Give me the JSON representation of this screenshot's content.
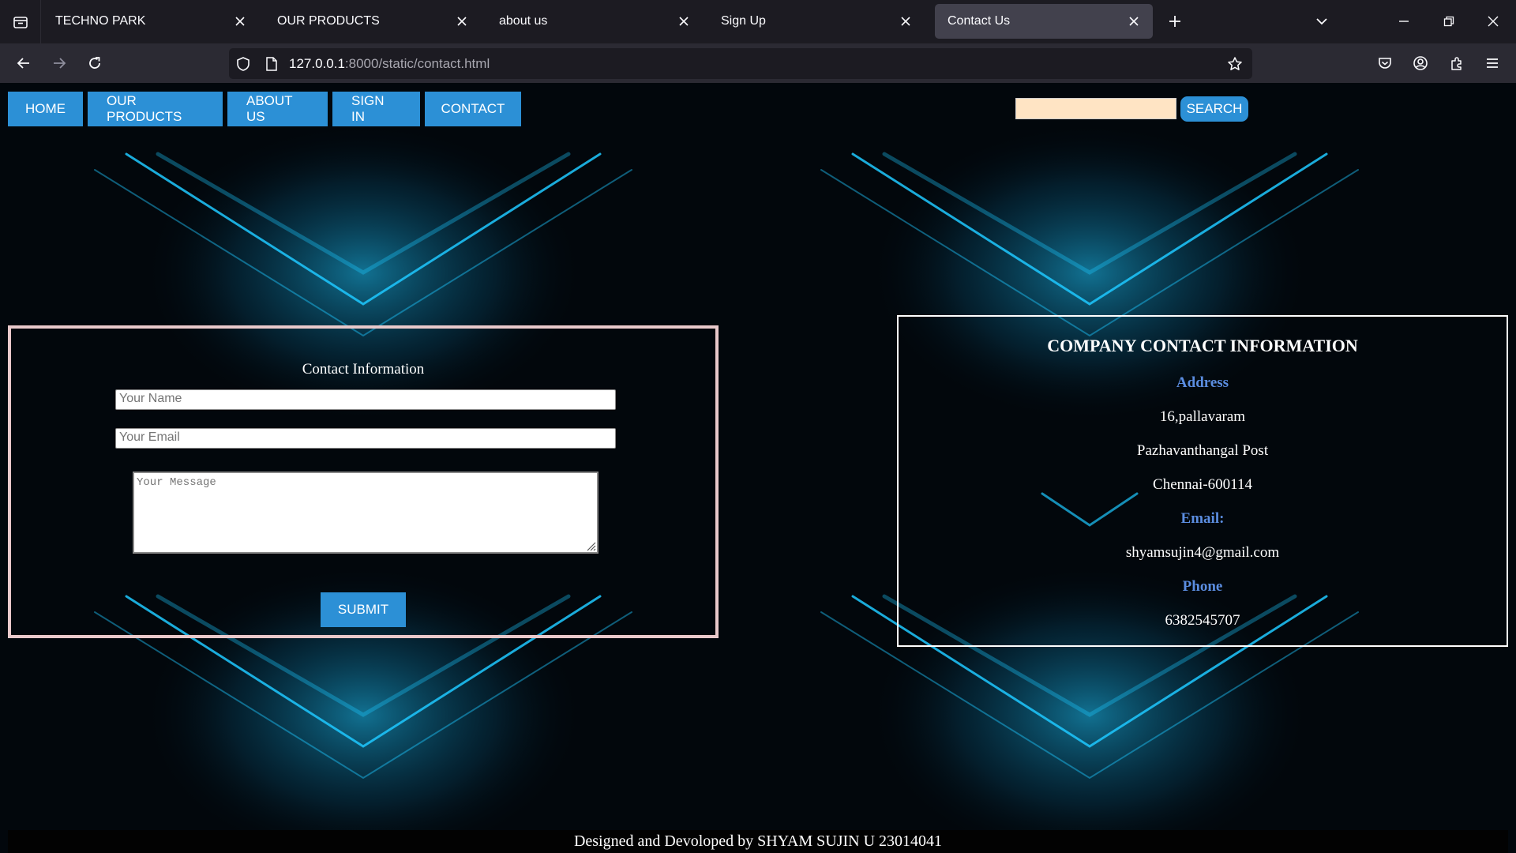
{
  "browser": {
    "tabs": [
      {
        "label": "TECHNO PARK",
        "active": false
      },
      {
        "label": "OUR PRODUCTS",
        "active": false
      },
      {
        "label": "about us",
        "active": false
      },
      {
        "label": "Sign Up",
        "active": false
      },
      {
        "label": "Contact Us",
        "active": true
      }
    ],
    "url_host": "127.0.0.1",
    "url_rest": ":8000/static/contact.html",
    "icons": [
      "tab-list-icon",
      "close-icon",
      "new-tab-icon",
      "chevron-down-icon",
      "minimize-icon",
      "restore-icon",
      "window-close-icon",
      "back-icon",
      "forward-icon",
      "reload-icon",
      "shield-icon",
      "page-icon",
      "star-icon",
      "pocket-icon",
      "account-icon",
      "extensions-icon",
      "menu-icon"
    ]
  },
  "site": {
    "nav": [
      "HOME",
      "OUR PRODUCTS",
      "ABOUT US",
      "SIGN IN",
      "CONTACT"
    ],
    "search_label": "SEARCH",
    "search_value": ""
  },
  "form": {
    "title": "Contact Information",
    "name_placeholder": "Your Name",
    "email_placeholder": "Your Email",
    "message_placeholder": "Your Message",
    "submit_label": "SUBMIT"
  },
  "company": {
    "title": "COMPANY CONTACT INFORMATION",
    "address_heading": "Address",
    "address_line1": "16,pallavaram",
    "address_line2": "Pazhavanthangal Post",
    "address_line3": "Chennai-600114",
    "email_heading": "Email:",
    "email": "shyamsujin4@gmail.com",
    "phone_heading": "Phone",
    "phone": "6382545707"
  },
  "footer": {
    "text": "Designed and Devoloped by SHYAM SUJIN U 23014041"
  },
  "colors": {
    "button": "#2c90d6",
    "search_field": "#ffe4c4",
    "form_border": "#e9c9cb",
    "heading": "#5b8de0",
    "glow": "#1ec8ff"
  }
}
